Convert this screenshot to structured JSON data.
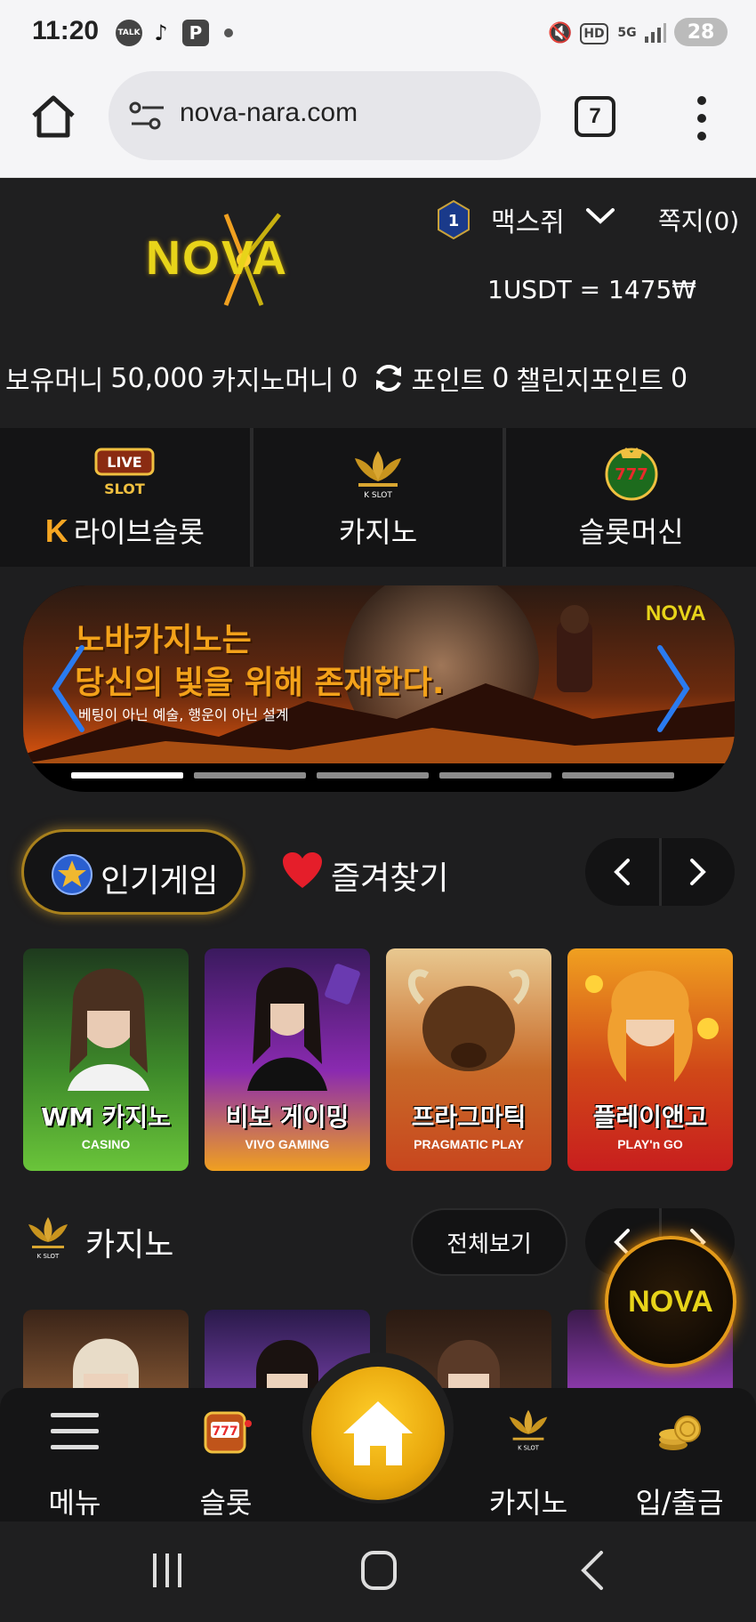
{
  "status_bar": {
    "time": "11:20",
    "talk_label": "TALK",
    "p_label": "P",
    "hd_label": "HD",
    "network_label": "5G",
    "battery": "28"
  },
  "browser": {
    "url": "nova-nara.com",
    "tab_count": "7"
  },
  "header": {
    "logo_text": "NOVA",
    "level": "1",
    "username": "맥스쥐",
    "messages": "쪽지(0)",
    "exchange_rate": "1USDT = 1475₩"
  },
  "balances": {
    "cash_label": "보유머니",
    "cash_value": "50,000",
    "casino_label": "카지노머니",
    "casino_value": "0",
    "point_label": "포인트",
    "point_value": "0",
    "challenge_label": "챌린지포인트",
    "challenge_value": "0"
  },
  "categories": {
    "live_slot": "라이브슬롯",
    "casino": "카지노",
    "slot_machine": "슬롯머신",
    "live_icon_text1": "LIVE",
    "live_icon_text2": "SLOT",
    "kslot_text": "K SLOT",
    "slots_icon_text": "777"
  },
  "banner": {
    "title_line1": "노바카지노는",
    "title_line2": "당신의 빛을 위해 존재한다.",
    "subtitle": "베팅이 아닌 예술, 행운이 아닌 설계",
    "logo": "NOVA"
  },
  "section_tabs": {
    "popular": "인기게임",
    "favorites": "즐겨찾기"
  },
  "games": [
    {
      "title": "WM 카지노",
      "brand": "CASINO"
    },
    {
      "title": "비보 게이밍",
      "brand": "VIVO GAMING"
    },
    {
      "title": "프라그마틱",
      "brand": "PRAGMATIC PLAY"
    },
    {
      "title": "플레이앤고",
      "brand": "PLAY'n GO"
    }
  ],
  "casino_section": {
    "title": "카지노",
    "view_all": "전체보기"
  },
  "float_logo": "NOVA",
  "bottom_nav": {
    "menu": "메뉴",
    "slot": "슬롯",
    "casino": "카지노",
    "deposit": "입/출금"
  },
  "colors": {
    "accent_gold": "#e8a60c",
    "background": "#1e1e1f",
    "nova_yellow": "#e8d41a"
  }
}
